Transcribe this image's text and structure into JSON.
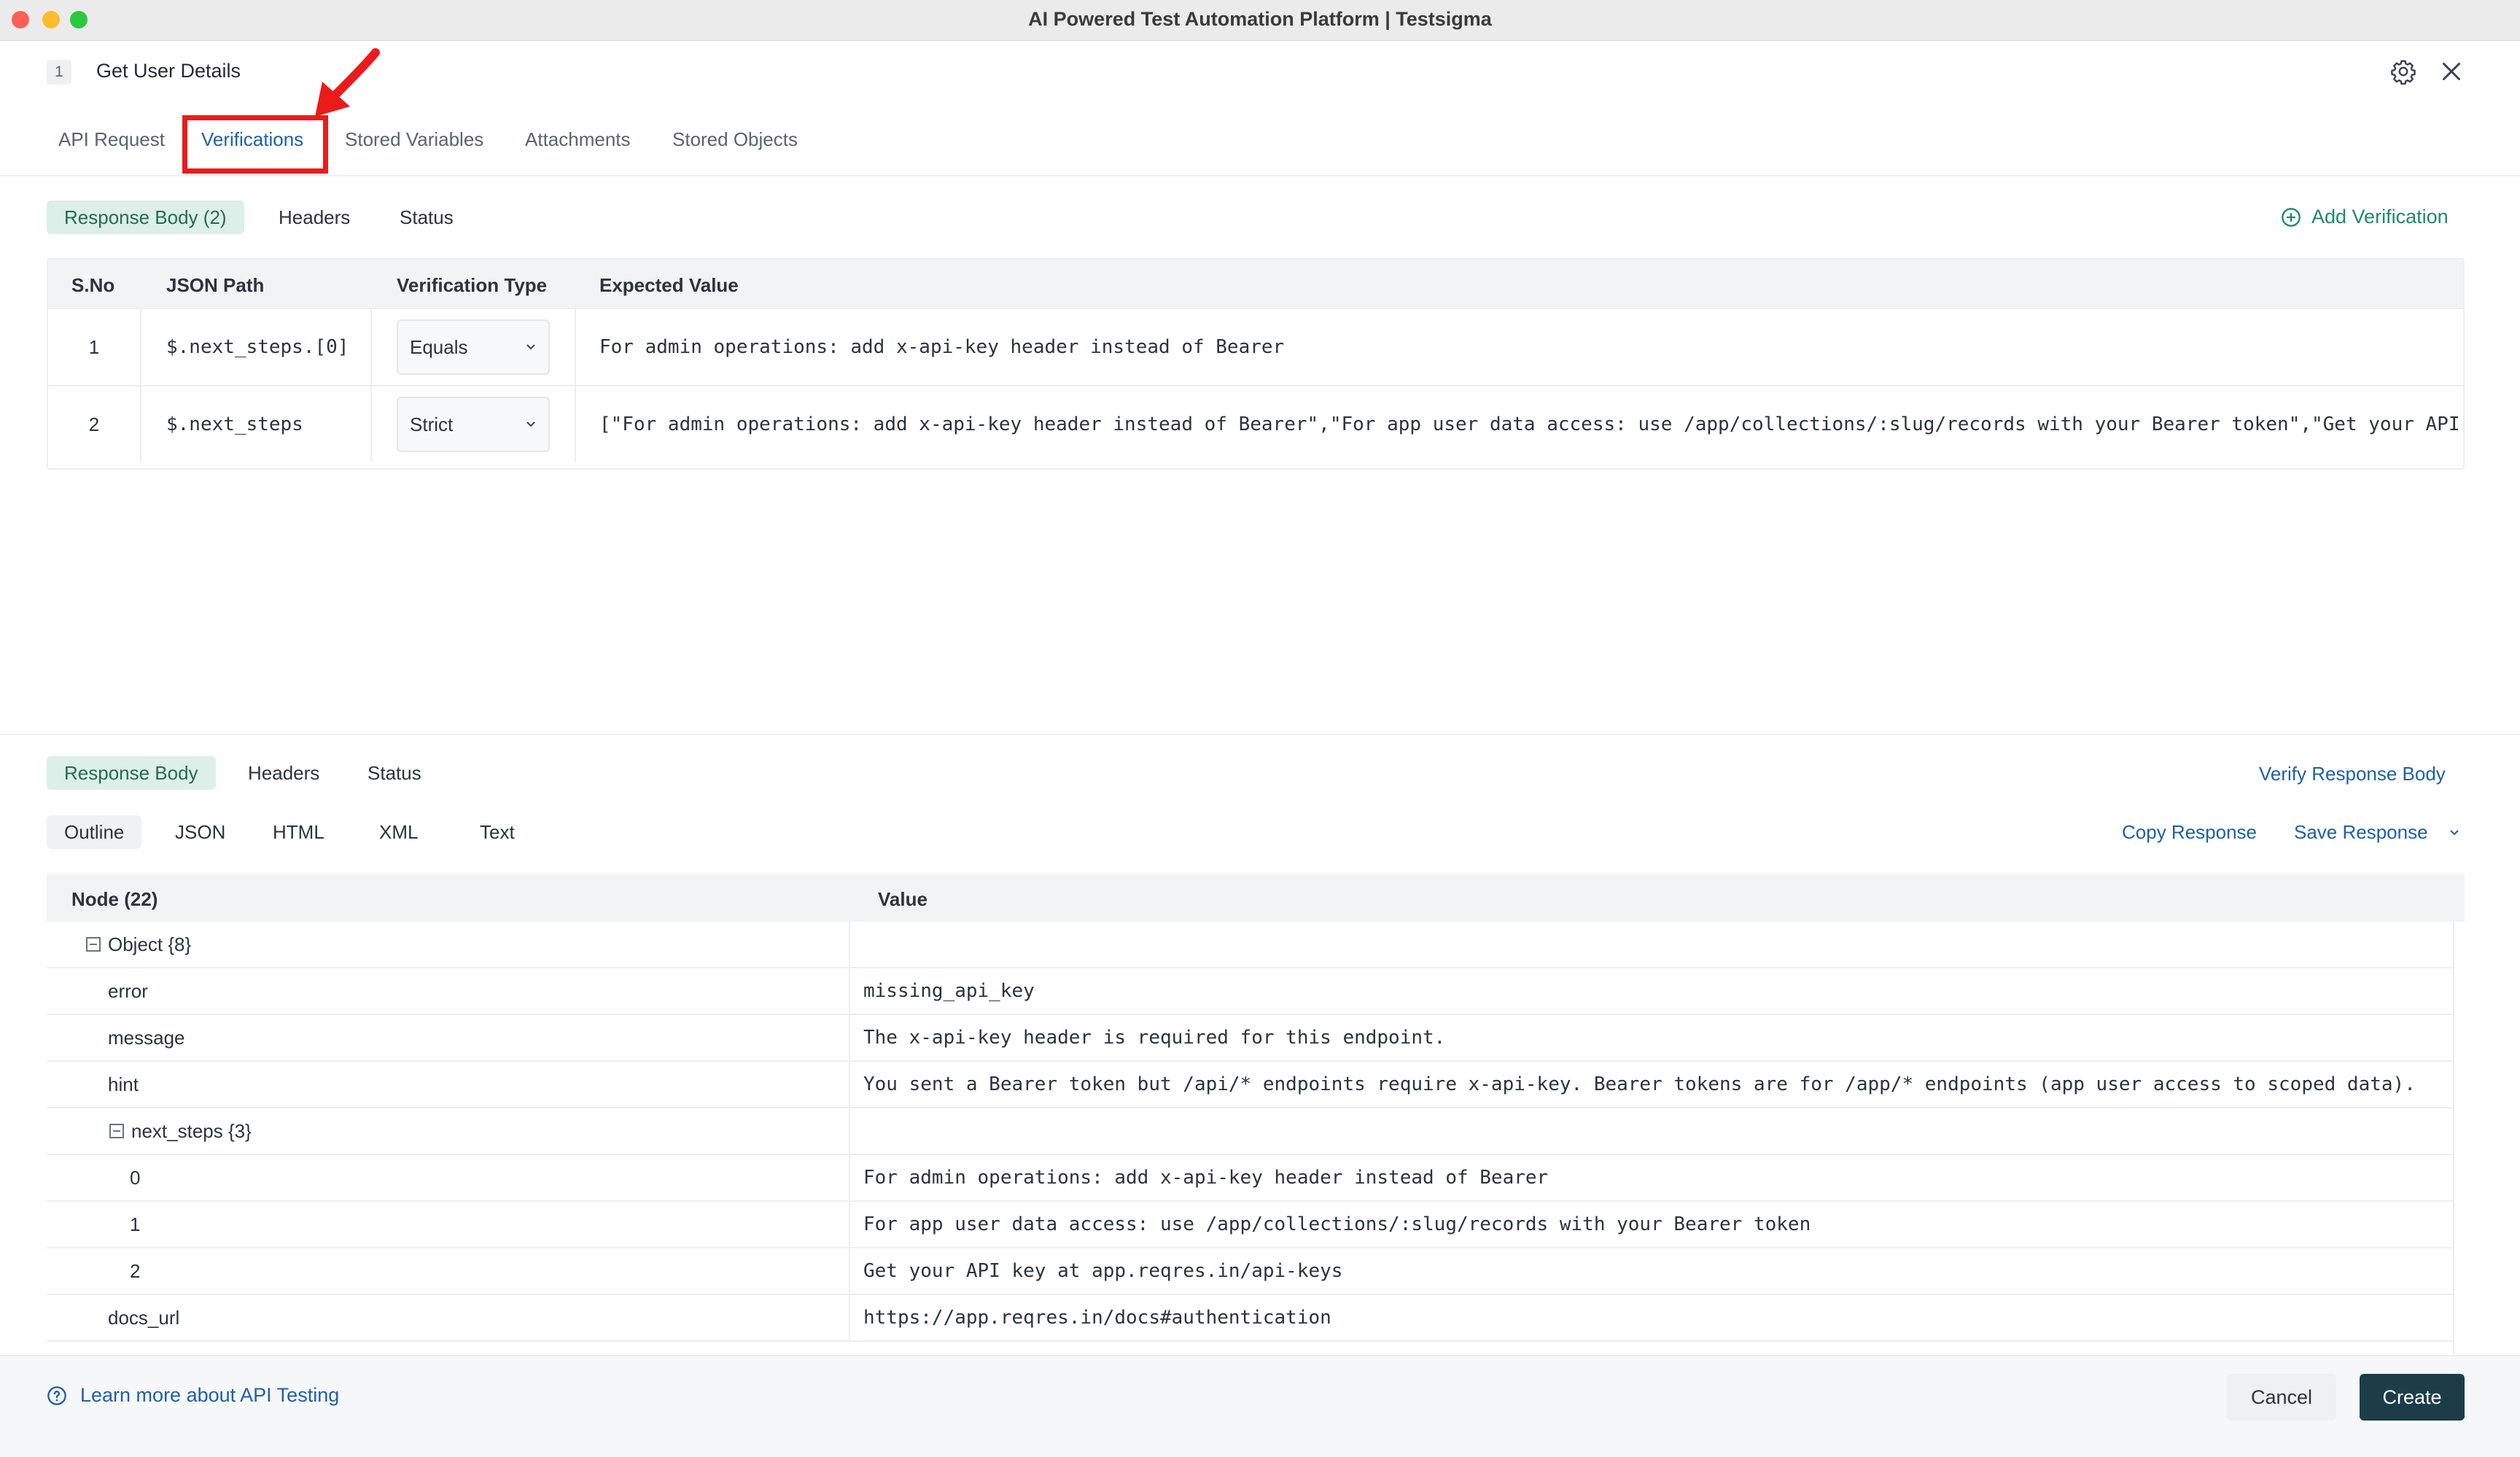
{
  "window": {
    "title": "AI Powered Test Automation Platform | Testsigma"
  },
  "step": {
    "number": "1",
    "title": "Get User Details"
  },
  "main_tabs": [
    {
      "label": "API Request"
    },
    {
      "label": "Verifications",
      "active": true
    },
    {
      "label": "Stored Variables"
    },
    {
      "label": "Attachments"
    },
    {
      "label": "Stored Objects"
    }
  ],
  "verification_tabs": [
    {
      "label": "Response Body (2)",
      "active": true
    },
    {
      "label": "Headers"
    },
    {
      "label": "Status"
    }
  ],
  "add_verification": "Add Verification",
  "verifications": {
    "headers": [
      "S.No",
      "JSON Path",
      "Verification Type",
      "Expected Value"
    ],
    "rows": [
      {
        "sno": "1",
        "path": "$.next_steps.[0]",
        "type": "Equals",
        "expected": "For admin operations: add x-api-key header instead of Bearer"
      },
      {
        "sno": "2",
        "path": "$.next_steps",
        "type": "Strict",
        "expected": "[\"For admin operations: add x-api-key header instead of Bearer\",\"For app user data access: use /app/collections/:slug/records with your Bearer token\",\"Get your API"
      }
    ]
  },
  "response_tabs": [
    {
      "label": "Response Body",
      "active": true
    },
    {
      "label": "Headers"
    },
    {
      "label": "Status"
    }
  ],
  "verify_response_body": "Verify Response Body",
  "format_tabs": [
    {
      "label": "Outline",
      "active": true
    },
    {
      "label": "JSON"
    },
    {
      "label": "HTML"
    },
    {
      "label": "XML"
    },
    {
      "label": "Text"
    }
  ],
  "copy_response": "Copy Response",
  "save_response": "Save Response",
  "nodes": {
    "headers": [
      "Node (22)",
      "Value"
    ],
    "rows": [
      {
        "node": "Object {8}",
        "value": "",
        "level": 0,
        "collapsible": true
      },
      {
        "node": "error",
        "value": "missing_api_key",
        "level": 1
      },
      {
        "node": "message",
        "value": "The x-api-key header is required for this endpoint.",
        "level": 1
      },
      {
        "node": "hint",
        "value": "You sent a Bearer token but /api/* endpoints require x-api-key. Bearer tokens are for /app/* endpoints (app user access to scoped data).",
        "level": 1
      },
      {
        "node": "next_steps {3}",
        "value": "",
        "level": 1,
        "collapsible": true
      },
      {
        "node": "0",
        "value": "For admin operations: add x-api-key header instead of Bearer",
        "level": 2
      },
      {
        "node": "1",
        "value": "For app user data access: use /app/collections/:slug/records with your Bearer token",
        "level": 2
      },
      {
        "node": "2",
        "value": "Get your API key at app.reqres.in/api-keys",
        "level": 2
      },
      {
        "node": "docs_url",
        "value": "https://app.reqres.in/docs#authentication",
        "level": 1
      }
    ]
  },
  "footer": {
    "help_link": "Learn more about API Testing",
    "cancel": "Cancel",
    "create": "Create"
  },
  "colors": {
    "accent_green": "#1f8a64",
    "link_blue": "#1f5fa8",
    "highlight_red": "#ec1b1b",
    "primary_button": "#1c3d47"
  }
}
